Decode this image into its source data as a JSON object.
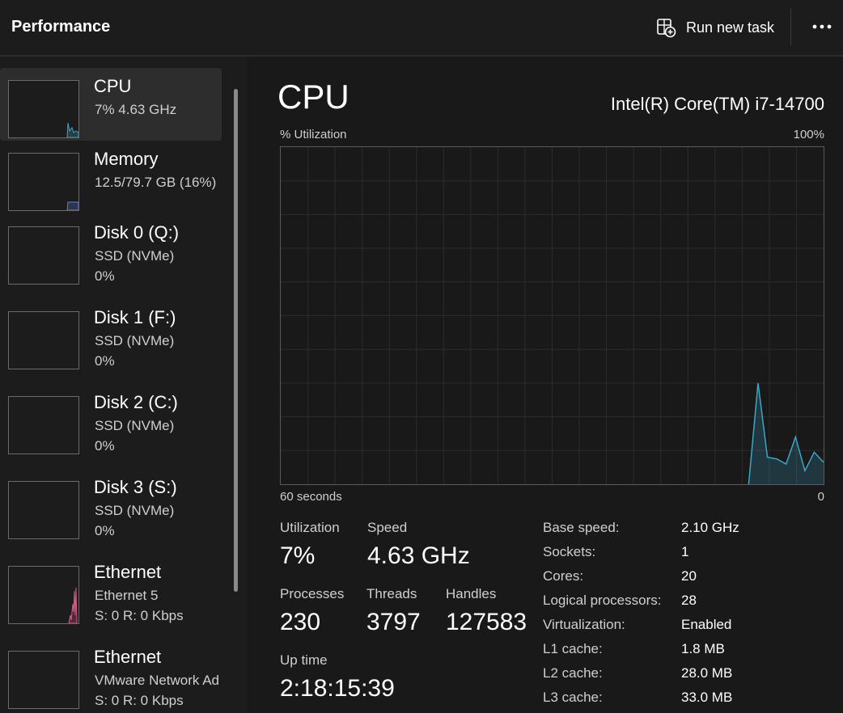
{
  "header": {
    "title": "Performance",
    "run_new_task": "Run new task",
    "more_icon": "ellipsis-icon",
    "run_icon": "run-task-icon"
  },
  "sidebar": {
    "items": [
      {
        "name": "CPU",
        "sub1": "7%  4.63 GHz",
        "sub2": "",
        "color": "#3aa6c9"
      },
      {
        "name": "Memory",
        "sub1": "12.5/79.7 GB (16%)",
        "sub2": "",
        "color": "#5b7ed6"
      },
      {
        "name": "Disk 0 (Q:)",
        "sub1": "SSD (NVMe)",
        "sub2": "0%",
        "color": "#4ea64e"
      },
      {
        "name": "Disk 1 (F:)",
        "sub1": "SSD (NVMe)",
        "sub2": "0%",
        "color": "#4ea64e"
      },
      {
        "name": "Disk 2 (C:)",
        "sub1": "SSD (NVMe)",
        "sub2": "0%",
        "color": "#4ea64e"
      },
      {
        "name": "Disk 3 (S:)",
        "sub1": "SSD (NVMe)",
        "sub2": "0%",
        "color": "#4ea64e"
      },
      {
        "name": "Ethernet",
        "sub1": "Ethernet 5",
        "sub2": "S: 0  R: 0 Kbps",
        "color": "#d85a88"
      },
      {
        "name": "Ethernet",
        "sub1": "VMware Network Ad",
        "sub2": "S: 0  R: 0 Kbps",
        "color": "#d85a88"
      }
    ]
  },
  "main": {
    "title": "CPU",
    "model": "Intel(R) Core(TM) i7-14700",
    "graph": {
      "ylabel": "% Utilization",
      "ymax_label": "100%",
      "xlabel": "60 seconds",
      "xmin_label": "0",
      "line_color": "#3aa6c9",
      "samples_percent": [
        0,
        0,
        0,
        0,
        0,
        0,
        0,
        0,
        0,
        0,
        0,
        0,
        0,
        0,
        0,
        0,
        0,
        0,
        0,
        0,
        0,
        0,
        0,
        0,
        0,
        0,
        0,
        0,
        0,
        0,
        0,
        0,
        0,
        0,
        0,
        0,
        0,
        0,
        0,
        0,
        0,
        0,
        0,
        0,
        0,
        0,
        0,
        0,
        0,
        0,
        0,
        30,
        8,
        7.5,
        6,
        14,
        4,
        9.5,
        6.5
      ]
    },
    "stats": {
      "utilization_label": "Utilization",
      "utilization_value": "7%",
      "speed_label": "Speed",
      "speed_value": "4.63 GHz",
      "processes_label": "Processes",
      "processes_value": "230",
      "threads_label": "Threads",
      "threads_value": "3797",
      "handles_label": "Handles",
      "handles_value": "127583",
      "uptime_label": "Up time",
      "uptime_value": "2:18:15:39"
    },
    "specs": [
      {
        "label": "Base speed:",
        "value": "2.10 GHz"
      },
      {
        "label": "Sockets:",
        "value": "1"
      },
      {
        "label": "Cores:",
        "value": "20"
      },
      {
        "label": "Logical processors:",
        "value": "28"
      },
      {
        "label": "Virtualization:",
        "value": "Enabled"
      },
      {
        "label": "L1 cache:",
        "value": "1.8 MB"
      },
      {
        "label": "L2 cache:",
        "value": "28.0 MB"
      },
      {
        "label": "L3 cache:",
        "value": "33.0 MB"
      }
    ]
  }
}
